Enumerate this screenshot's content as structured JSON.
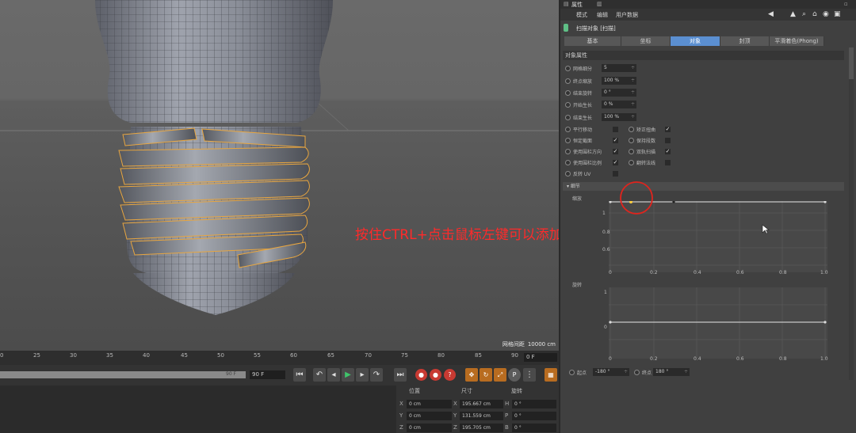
{
  "viewport": {
    "grid_size_label": "网格间距",
    "grid_size_value": "10000 cm",
    "overlay_instruction": "按住CTRL+点击鼠标左键可以添加点"
  },
  "timeline": {
    "ticks": [
      "0",
      "25",
      "30",
      "35",
      "40",
      "45",
      "50",
      "55",
      "60",
      "65",
      "70",
      "75",
      "80",
      "85",
      "90"
    ],
    "end_field": "0 F",
    "range_value": "90 F",
    "frame_field": "90 F"
  },
  "coords": {
    "headers": [
      "位置",
      "尺寸",
      "旋转"
    ],
    "rows": [
      {
        "axis_pos": "X",
        "pos": "0 cm",
        "axis_size": "X",
        "size": "195.667 cm",
        "axis_rot": "H",
        "rot": "0 °"
      },
      {
        "axis_pos": "Y",
        "pos": "0 cm",
        "axis_size": "Y",
        "size": "131.559 cm",
        "axis_rot": "P",
        "rot": "0 °"
      },
      {
        "axis_pos": "Z",
        "pos": "0 cm",
        "axis_size": "Z",
        "size": "195.705 cm",
        "axis_rot": "B",
        "rot": "0 °"
      }
    ]
  },
  "attributes": {
    "top_tab": "属性",
    "menu": [
      "模式",
      "编辑",
      "用户数据"
    ],
    "object_title": "扫描对象 [扫描]",
    "tabs": [
      "基本",
      "坐标",
      "对象",
      "封顶",
      "平滑着色(Phong)"
    ],
    "active_tab": "对象",
    "section": "对象属性",
    "fields": [
      {
        "label": "网格细分",
        "value": "5"
      },
      {
        "label": "终点缩放",
        "value": "100 %"
      },
      {
        "label": "结束旋转",
        "value": "0 °"
      },
      {
        "label": "开始生长",
        "value": "0 %"
      },
      {
        "label": "结束生长",
        "value": "100 %"
      }
    ],
    "checks_left": [
      {
        "label": "平行移动",
        "checked": false
      },
      {
        "label": "恒定截面",
        "checked": true
      },
      {
        "label": "使用围栏方向",
        "checked": true
      },
      {
        "label": "使用围栏比例",
        "checked": true
      },
      {
        "label": "反转 UV",
        "checked": false
      }
    ],
    "checks_right": [
      {
        "label": "矫正扭曲",
        "checked": true
      },
      {
        "label": "保持段数",
        "checked": false
      },
      {
        "label": "双轨扫描",
        "checked": true
      },
      {
        "label": "翻转法线",
        "checked": false
      }
    ],
    "details_header": "▾ 细节",
    "graph1_label": "缩放",
    "graph2_label": "旋转",
    "graph_x_ticks": [
      "0",
      "0.2",
      "0.4",
      "0.6",
      "0.8",
      "1.0"
    ],
    "graph1_y_ticks": [
      "1",
      "0.8",
      "0.6"
    ],
    "graph2_y_ticks": [
      "1",
      "0"
    ],
    "bottom": [
      {
        "label": "起点",
        "value": "-180 °"
      },
      {
        "label": "终点",
        "value": "180 °"
      }
    ]
  }
}
